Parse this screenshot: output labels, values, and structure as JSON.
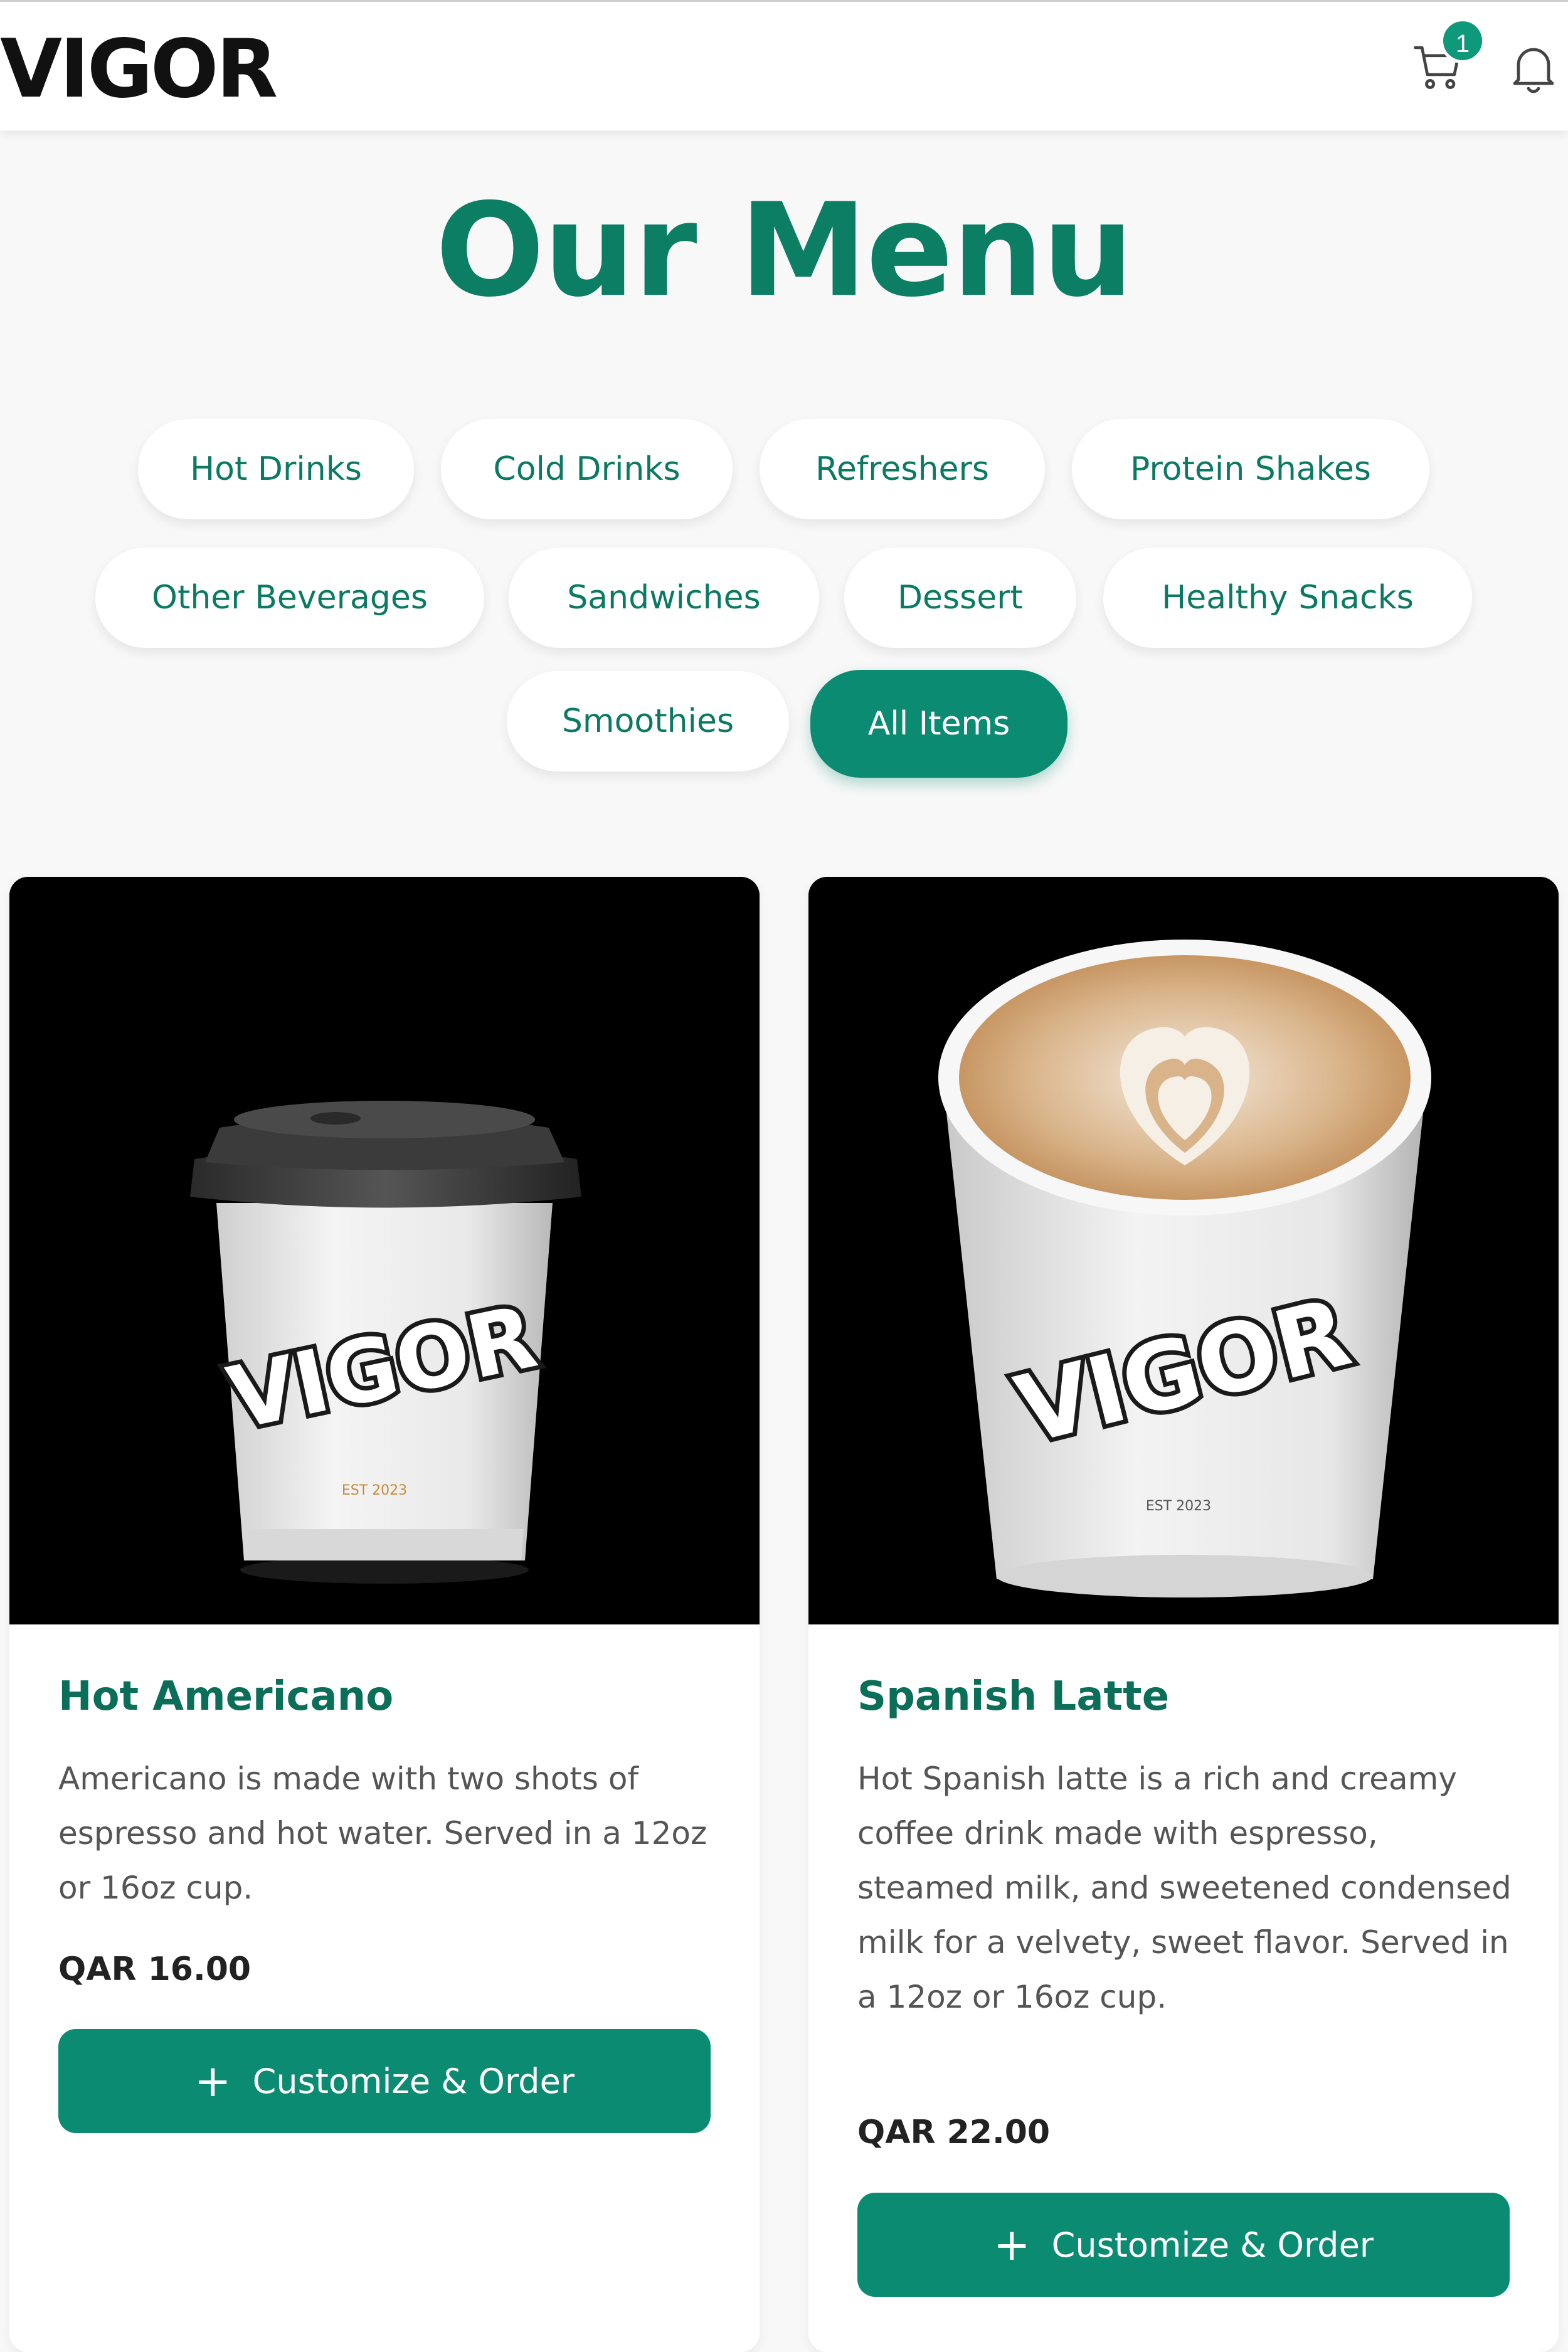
{
  "header": {
    "logo_text": "VIGOR",
    "cart_icon": "cart-icon",
    "cart_count": "1",
    "bell_icon": "bell-icon"
  },
  "page_title": "Our Menu",
  "categories": [
    {
      "label": "Hot Drinks"
    },
    {
      "label": "Cold Drinks"
    },
    {
      "label": "Refreshers"
    },
    {
      "label": "Protein Shakes"
    },
    {
      "label": "Other Beverages"
    },
    {
      "label": "Sandwiches"
    },
    {
      "label": "Dessert"
    },
    {
      "label": "Healthy Snacks"
    },
    {
      "label": "Smoothies"
    },
    {
      "label": "All Items",
      "active": true
    }
  ],
  "items": [
    {
      "name": "Hot Americano",
      "description": "Americano is made with two shots of espresso and hot water. Served in a 12oz or 16oz cup.",
      "price": "QAR 16.00",
      "button_icon": "+",
      "button_label": "Customize & Order",
      "cup_brand": "VIGOR",
      "cup_est": "EST 2023"
    },
    {
      "name": "Spanish Latte",
      "description": "Hot Spanish latte is a rich and creamy coffee drink made with espresso, steamed milk, and sweetened condensed milk for a velvety, sweet flavor. Served in a 12oz or 16oz cup.",
      "price": "QAR 22.00",
      "button_icon": "+",
      "button_label": "Customize & Order",
      "cup_brand": "VIGOR",
      "cup_est": "EST 2023"
    }
  ],
  "colors": {
    "brand": "#0b8c72",
    "title": "#0b7e64",
    "background": "#f8f8f8"
  }
}
